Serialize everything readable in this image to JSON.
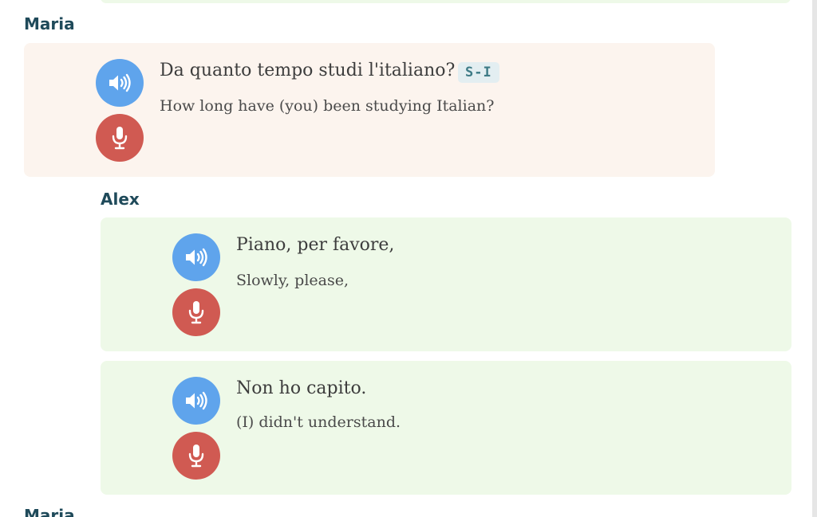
{
  "colors": {
    "speaker_name": "#1f4a5a",
    "maria_card_bg": "#fcf4ee",
    "alex_card_bg": "#eef9e8",
    "audio_button": "#5fa4ec",
    "mic_button": "#d05a52",
    "tag_text": "#3e7b86",
    "tag_bg": "#e3eef1"
  },
  "dialogue": [
    {
      "speaker": "Maria",
      "lines": [
        {
          "phrase": "Da quanto tempo studi l'italiano?",
          "translation": "How long have (you) been studying Italian?",
          "tag": "S-I",
          "audio_icon": "speaker-icon",
          "mic_icon": "microphone-icon"
        }
      ]
    },
    {
      "speaker": "Alex",
      "lines": [
        {
          "phrase": "Piano, per favore,",
          "translation": "Slowly, please,",
          "audio_icon": "speaker-icon",
          "mic_icon": "microphone-icon"
        },
        {
          "phrase": "Non ho capito.",
          "translation": "(I) didn't understand.",
          "audio_icon": "speaker-icon",
          "mic_icon": "microphone-icon"
        }
      ]
    },
    {
      "speaker": "Maria",
      "lines": []
    }
  ]
}
